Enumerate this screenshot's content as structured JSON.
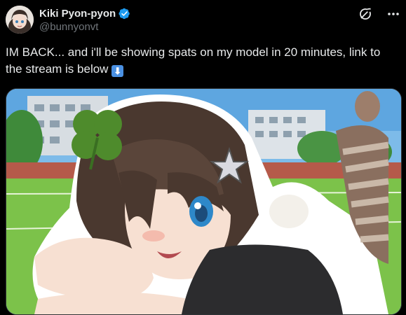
{
  "author": {
    "display_name": "Kiki Pyon-pyon",
    "handle": "@bunnyonvt",
    "verified_icon": "verified-badge-icon",
    "avatar_icon": "avatar"
  },
  "header_icons": [
    "grok-icon",
    "more-icon"
  ],
  "tweet": {
    "text": "IM BACK... and i'll be showing spats on my model in 20 minutes, link to the stream is below",
    "emoji": "⬇"
  },
  "colors": {
    "background": "#000000",
    "text": "#e7e9ea",
    "secondary_text": "#71767b",
    "verified_blue": "#1d9bf0"
  }
}
